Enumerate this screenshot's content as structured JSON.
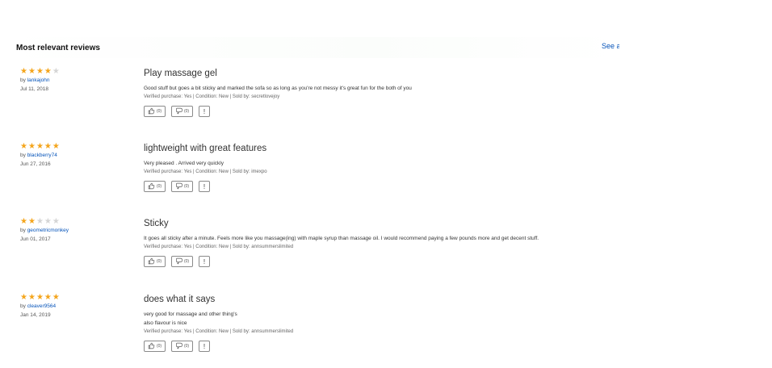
{
  "header": {
    "title": "Most relevant reviews",
    "see_all_label": "See all"
  },
  "colors": {
    "star_filled": "#f4a51c",
    "star_empty": "#d5d5d5",
    "link": "#0654ba"
  },
  "reviews": [
    {
      "rating": 4,
      "by_prefix": "by",
      "author": "lankajohn",
      "date": "Jul 11, 2018",
      "title": "Play massage gel",
      "body": [
        "Good stuff but goes a bit sticky and marked the sofa so as long as you're not messy it's great fun for the both of you"
      ],
      "meta": "Verified purchase: Yes | Condition: New | Sold by: secretlovejoy",
      "helpful_count": "(0)",
      "unhelpful_count": "(0)",
      "report_label": "!"
    },
    {
      "rating": 5,
      "by_prefix": "by",
      "author": "blackberry74",
      "date": "Jun 27, 2016",
      "title": "lightweight with great features",
      "body": [
        "Very pleased . Arrived very quickly"
      ],
      "meta": "Verified purchase: Yes | Condition: New | Sold by: imexpo",
      "helpful_count": "(0)",
      "unhelpful_count": "(0)",
      "report_label": "!"
    },
    {
      "rating": 2,
      "by_prefix": "by",
      "author": "geometricmonkey",
      "date": "Jun 01, 2017",
      "title": "Sticky",
      "body": [
        "It goes all sticky after a minute. Feels more like you massage(ing) with maple syrup than massage oil. I would recommend paying a few pounds more and get decent stuff."
      ],
      "meta": "Verified purchase: Yes | Condition: New | Sold by: annsummerslimited",
      "helpful_count": "(0)",
      "unhelpful_count": "(0)",
      "report_label": "!"
    },
    {
      "rating": 5,
      "by_prefix": "by",
      "author": "cleaver9564",
      "date": "Jan 14, 2019",
      "title": "does what it says",
      "body": [
        "very good for massage and other thing's",
        "also flavour is nice"
      ],
      "meta": "Verified purchase: Yes | Condition: New | Sold by: annsummerslimited",
      "helpful_count": "(0)",
      "unhelpful_count": "(0)",
      "report_label": "!"
    }
  ]
}
